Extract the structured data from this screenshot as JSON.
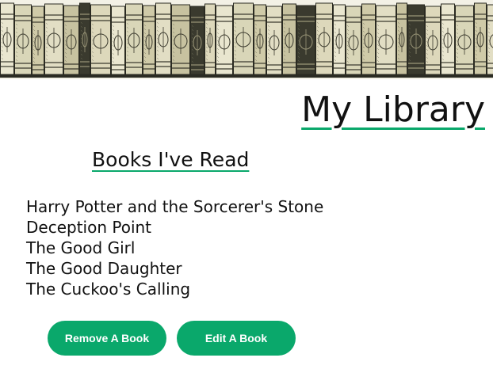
{
  "header": {
    "banner_image": "bookshelf-illustration",
    "title": "My Library"
  },
  "section": {
    "heading": "Books I've Read"
  },
  "books": [
    "Harry Potter and the Sorcerer's Stone",
    "Deception Point",
    "The Good Girl",
    "The Good Daughter",
    "The Cuckoo's Calling"
  ],
  "actions": {
    "remove_label": "Remove A Book",
    "edit_label": "Edit A Book"
  },
  "colors": {
    "accent": "#0aa86b",
    "text": "#111111",
    "button_text": "#ffffff"
  }
}
